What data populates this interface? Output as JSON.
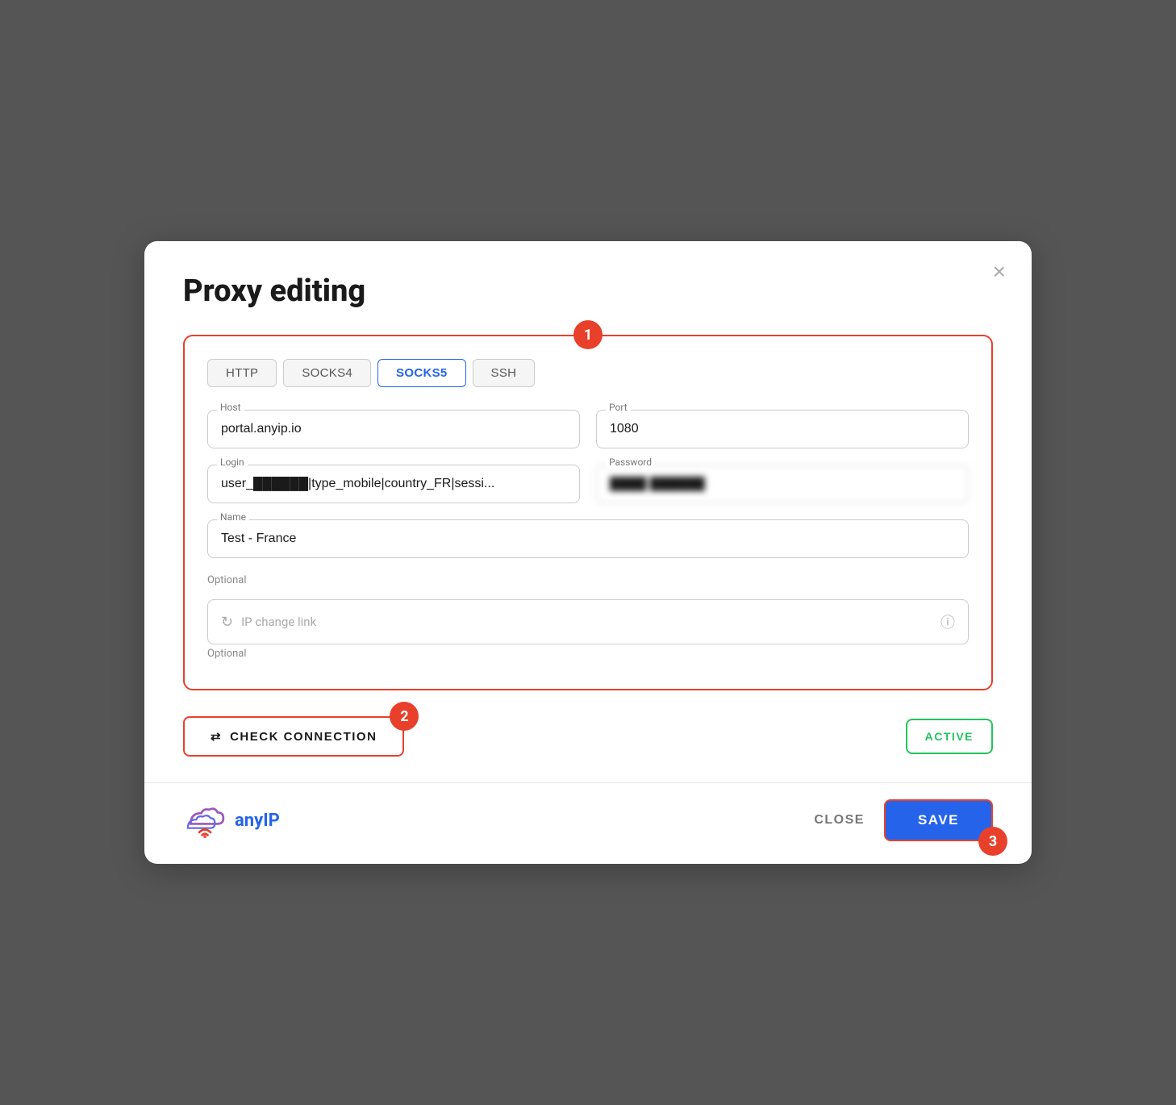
{
  "modal": {
    "title": "Proxy editing",
    "close_label": "×"
  },
  "tabs": [
    {
      "id": "http",
      "label": "HTTP",
      "active": false
    },
    {
      "id": "socks4",
      "label": "SOCKS4",
      "active": false
    },
    {
      "id": "socks5",
      "label": "SOCKS5",
      "active": true
    },
    {
      "id": "ssh",
      "label": "SSH",
      "active": false
    }
  ],
  "fields": {
    "host_label": "Host",
    "host_value": "portal.anyip.io",
    "port_label": "Port",
    "port_value": "1080",
    "login_label": "Login",
    "login_value": "user_██████|type_mobile|country_FR|sessi...",
    "password_label": "Password",
    "password_value": "████ ██████",
    "name_label": "Name",
    "name_value": "Test - France",
    "name_optional": "Optional",
    "ip_change_placeholder": "IP change link",
    "ip_change_optional": "Optional"
  },
  "badges": {
    "badge1": "1",
    "badge2": "2",
    "badge3": "3"
  },
  "buttons": {
    "check_connection": "CHECK CONNECTION",
    "active": "ACTIVE",
    "close": "CLOSE",
    "save": "SAVE"
  },
  "logo": {
    "text_any": "any",
    "text_ip": "IP"
  }
}
